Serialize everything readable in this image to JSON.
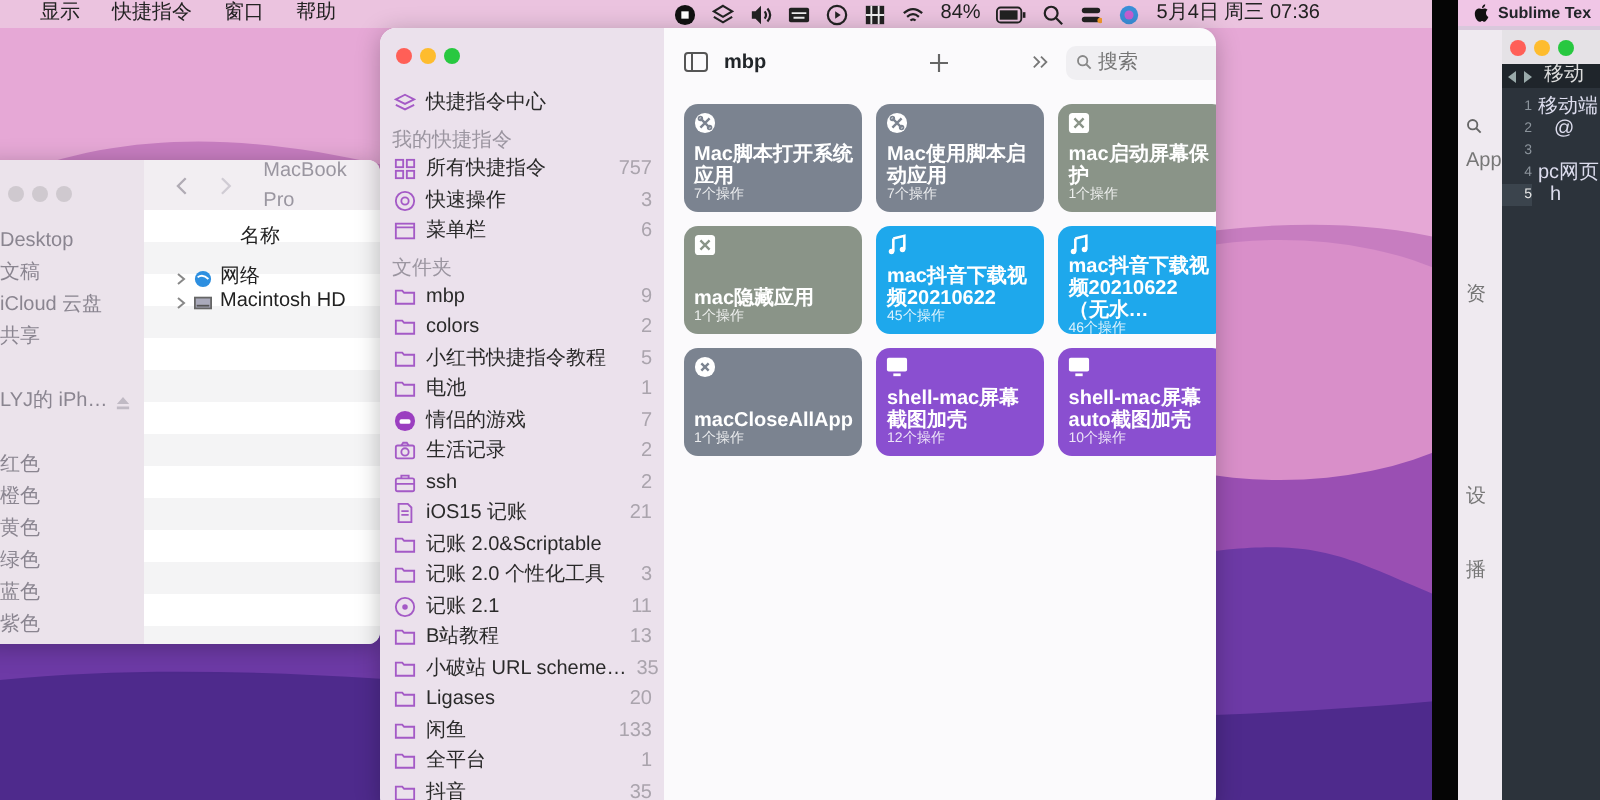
{
  "menu_bar": {
    "menus": [
      "显示",
      "快捷指令",
      "窗口",
      "帮助"
    ],
    "battery_percent": "84%",
    "clock": "5月4日 周三 07:36"
  },
  "finder": {
    "focused": false,
    "title": "MacBook Pro",
    "column": "名称",
    "locations": [
      "Desktop",
      "文稿",
      "iCloud 云盘",
      "共享"
    ],
    "devices": [
      "LYJ的 iPh…"
    ],
    "tags": [
      "红色",
      "橙色",
      "黄色",
      "绿色",
      "蓝色",
      "紫色"
    ],
    "rows": [
      {
        "name": "网络",
        "kind": "network"
      },
      {
        "name": "Macintosh HD",
        "kind": "disk"
      }
    ]
  },
  "shortcuts": {
    "focused": true,
    "gallery": "快捷指令中心",
    "sections": [
      {
        "title": "我的快捷指令",
        "items": [
          {
            "label": "所有快捷指令",
            "count": "757",
            "kind": "grid"
          },
          {
            "label": "快速操作",
            "count": "3",
            "kind": "gear"
          },
          {
            "label": "菜单栏",
            "count": "6",
            "kind": "window"
          }
        ]
      },
      {
        "title": "文件夹",
        "items": [
          {
            "label": "mbp",
            "count": "9",
            "kind": "folder"
          },
          {
            "label": "colors",
            "count": "2",
            "kind": "folder"
          },
          {
            "label": "小红书快捷指令教程",
            "count": "5",
            "kind": "folder"
          },
          {
            "label": "电池",
            "count": "1",
            "kind": "folder"
          },
          {
            "label": "情侣的游戏",
            "count": "7",
            "kind": "game"
          },
          {
            "label": "生活记录",
            "count": "2",
            "kind": "camera"
          },
          {
            "label": "ssh",
            "count": "2",
            "kind": "briefcase"
          },
          {
            "label": "iOS15 记账",
            "count": "21",
            "kind": "document"
          },
          {
            "label": "记账 2.0&Scriptable",
            "kind": "folder"
          },
          {
            "label": "记账 2.0 个性化工具",
            "count": "3",
            "kind": "folder"
          },
          {
            "label": "记账 2.1",
            "count": "11",
            "kind": "target"
          },
          {
            "label": "B站教程",
            "count": "13",
            "kind": "folder"
          },
          {
            "label": "小破站 URL scheme…",
            "count": "35",
            "kind": "folder"
          },
          {
            "label": "Ligases",
            "count": "20",
            "kind": "folder"
          },
          {
            "label": "闲鱼",
            "count": "133",
            "kind": "folder"
          },
          {
            "label": "全平台",
            "count": "1",
            "kind": "folder"
          },
          {
            "label": "抖音",
            "count": "35",
            "kind": "folder"
          }
        ]
      }
    ],
    "toolbar": {
      "title": "mbp",
      "search_placeholder": "搜索"
    },
    "cards": [
      {
        "title": "Mac脚本打开系统应用",
        "subtitle": "7个操作",
        "color": "#7b8390",
        "kind": "command-circle"
      },
      {
        "title": "Mac使用脚本启动应用",
        "subtitle": "7个操作",
        "color": "#7b8390",
        "kind": "command-circle"
      },
      {
        "title": "mac启动屏幕保护",
        "subtitle": "1个操作",
        "color": "#8a9488",
        "kind": "command-square"
      },
      {
        "title": "mac隐藏应用",
        "subtitle": "1个操作",
        "color": "#8a9488",
        "kind": "command-square"
      },
      {
        "title": "mac抖音下载视频20210622",
        "subtitle": "45个操作",
        "color": "#1ea8ec",
        "kind": "music"
      },
      {
        "title": "mac抖音下载视频20210622（无水…",
        "subtitle": "46个操作",
        "color": "#1ea8ec",
        "kind": "music"
      },
      {
        "title": "macCloseAllApp",
        "subtitle": "1个操作",
        "color": "#7b8390",
        "kind": "x-circle"
      },
      {
        "title": "shell-mac屏幕截图加壳",
        "subtitle": "12个操作",
        "color": "#8a4fd0",
        "kind": "monitor"
      },
      {
        "title": "shell-mac屏幕auto截图加壳",
        "subtitle": "10个操作",
        "color": "#8a4fd0",
        "kind": "monitor"
      }
    ]
  },
  "second_screen": {
    "app_menu": "Sublime Tex",
    "settings_labels": [
      "App",
      "资",
      "设",
      "播"
    ],
    "editor": {
      "focused": true,
      "tab": "移动",
      "lines": [
        {
          "number": "1",
          "text": "移动端",
          "current": false
        },
        {
          "number": "2",
          "text": "@",
          "current": false
        },
        {
          "number": "3",
          "current": false
        },
        {
          "number": "4",
          "text": "pc网页",
          "current": false
        },
        {
          "number": "5",
          "text": "h",
          "current": true
        }
      ]
    }
  }
}
